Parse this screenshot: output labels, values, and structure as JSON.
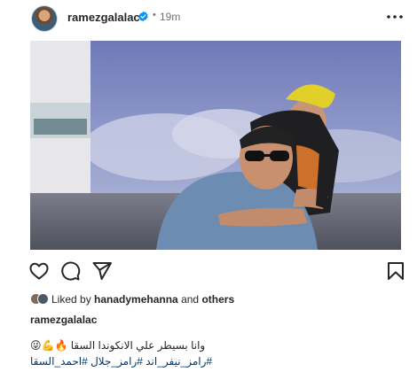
{
  "post": {
    "username": "ramezgalalac",
    "separator": "•",
    "time": "19m",
    "icons": {
      "avatar": "profile-avatar",
      "verified": "verified-badge-icon",
      "more": "more-options-icon",
      "like": "heart-icon",
      "comment": "comment-icon",
      "share": "paper-plane-icon",
      "save": "bookmark-icon"
    },
    "colors": {
      "verified": "#0095f6",
      "link": "#00376b",
      "muted": "#737373"
    }
  },
  "likes": {
    "prefix": "Liked by ",
    "user": "hanadymehanna",
    "middle": " and ",
    "others": "others"
  },
  "caption": {
    "username": "ramezgalalac",
    "line1": "وانا بسيطر علي الانكوندا السقا 🔥💪😜",
    "hashtags": "#رامز_نيفر_اند #رامز_جلال #احمد_السقا"
  }
}
